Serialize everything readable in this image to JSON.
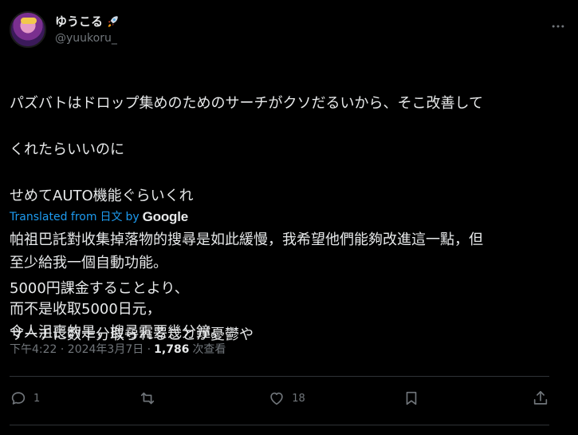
{
  "author": {
    "display_name": "ゆうこる",
    "handle": "@yuukoru_",
    "badge_icon": "rocket-icon"
  },
  "tweet": {
    "lines": [
      "パズバトはドロップ集めのためのサーチがクソだるいから、そこ改善して",
      "くれたらいいのに",
      "せめてAUTO機能ぐらいくれ",
      "",
      "5000円課金することより、",
      "サーチに数十分取られることが憂鬱や"
    ]
  },
  "translation": {
    "label": "Translated from",
    "language": "日文",
    "by": "by",
    "provider": "Google",
    "lines": [
      "帕祖巴託對收集掉落物的搜尋是如此緩慢，我希望他們能夠改進這一點，但",
      "至少給我一個自動功能。",
      "",
      "而不是收取5000日元，",
      "令人沮喪的是，搜尋需要幾分鐘。"
    ]
  },
  "meta": {
    "time": "下午4:22 · 2024年3月7日 ·",
    "views_count": "1,786",
    "views_label": "次查看"
  },
  "actions": {
    "reply_count": "1",
    "repost_count": "",
    "like_count": "18"
  },
  "colors": {
    "background": "#000000",
    "text": "#e7e9ea",
    "muted": "#71767b",
    "link": "#1d9bf0",
    "divider": "#2f3336"
  }
}
